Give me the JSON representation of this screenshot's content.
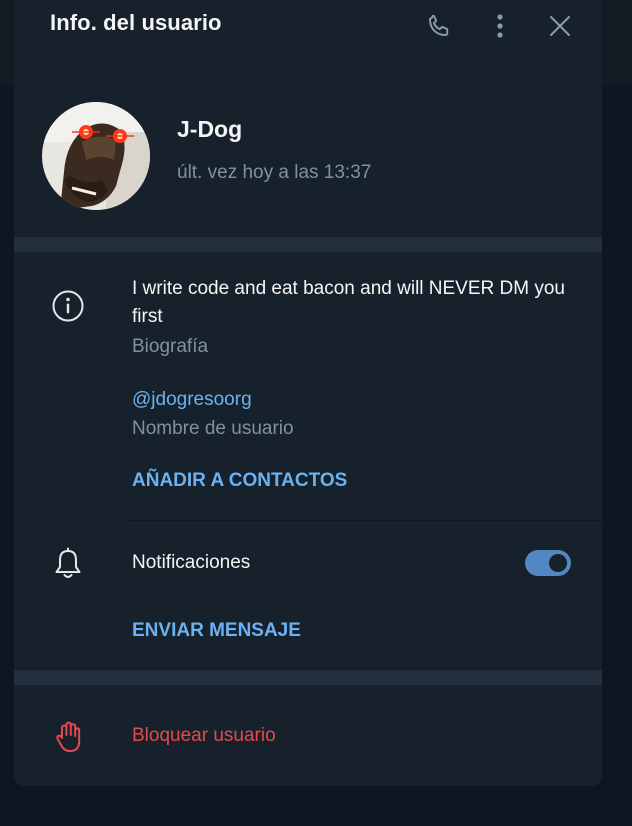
{
  "header": {
    "title": "Info. del usuario",
    "icons": [
      "phone-icon",
      "more-vertical-icon",
      "close-icon"
    ]
  },
  "profile": {
    "name": "J-Dog",
    "status": "últ. vez hoy a las 13:37",
    "avatar_icon": "avatar-horse-mask"
  },
  "info": {
    "bio": "I write code and eat bacon and will NEVER DM you first",
    "bio_label": "Biografía",
    "username": "@jdogresoorg",
    "username_label": "Nombre de usuario",
    "add_contact": "AÑADIR A CONTACTOS"
  },
  "notifications": {
    "label": "Notificaciones",
    "enabled": true
  },
  "actions": {
    "send_message": "ENVIAR MENSAJE",
    "block_user": "Bloquear usuario"
  },
  "colors": {
    "background": "#17212b",
    "accent": "#6ab2f2",
    "toggle": "#5288c1",
    "danger": "#e5484d",
    "muted": "#7f91a4"
  }
}
